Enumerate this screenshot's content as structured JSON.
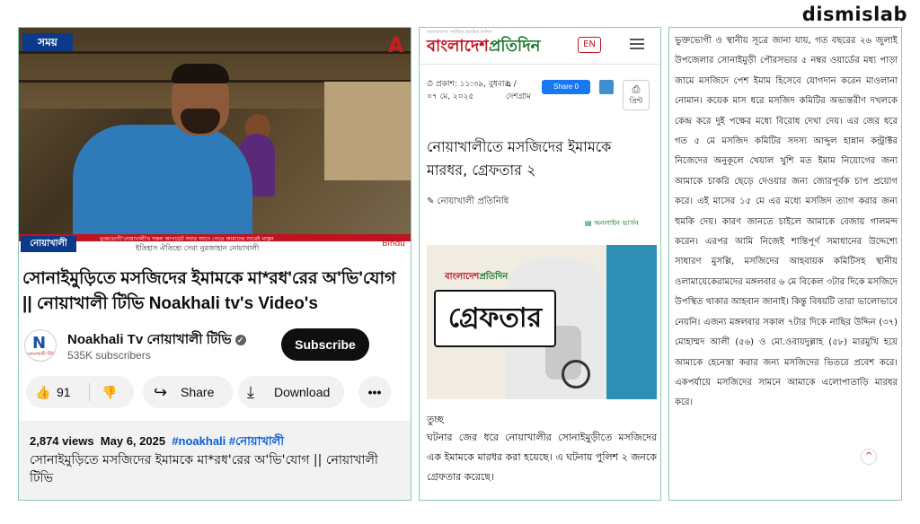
{
  "brand": "dismislab",
  "youtube": {
    "video_overlay": {
      "channel_logo_text": "সময়",
      "corner_logo": "A",
      "ticker_tag": "নোয়াখালী টিভি",
      "ticker_line1": "ভুক্তভোগী'নোয়াখালী'র সকল আপডেট সবার আগে পেতে আমাদের সাথেই থাকুন",
      "ticker_line2": "ইতিহাস ঐতিহ্যে সেরা নুরজাহান নোয়াখালী",
      "ticker_logo": "Bindu"
    },
    "title": "সোনাইমুড়িতে মসজিদের ইমামকে মা*রধ'রের অ'ভি'যোগ || নোয়াখালী টিভি Noakhali tv's Video's",
    "channel": {
      "avatar_letter": "N",
      "avatar_sub": "নোয়াখালী টিভি",
      "name": "Noakhali Tv নোয়াখালী টিভি",
      "subscribers": "535K subscribers",
      "subscribe_label": "Subscribe"
    },
    "actions": {
      "like_icon": "👍",
      "likes": "91",
      "dislike_icon": "👎",
      "share_icon": "↪",
      "share_label": "Share",
      "download_icon": "⤓",
      "download_label": "Download",
      "more_icon": "•••"
    },
    "description": {
      "views": "2,874 views",
      "date": "May 6, 2025",
      "tags": "#noakhali #নোয়াখালী",
      "text": "সোনাইমুড়িতে মসজিদের ইমামকে মা*রধ'রের অ'ভি'যোগ || নোয়াখালী টিভি"
    }
  },
  "pratidin": {
    "tagline": "বাংলাদেশের সর্বাধিক প্রচারিত দৈনিক",
    "logo_red": "বাংলাদেশ",
    "logo_green": "প্রতিদিন",
    "lang_button": "EN",
    "published": "⏱ প্রকাশ: ১১:৩৯, বুধবার, ০৭ মে, ২০২৫",
    "location": "⌂ / দেশগ্রাম",
    "fb_share": "Share 0",
    "print_label": "প্রিন্ট",
    "headline": "নোয়াখালীতে মসজিদের ইমামকে মারধর, গ্রেফতার ২",
    "author": "✎ নোয়াখালী প্রতিনিধি",
    "online_version": "▤ অনলাইন ভার্সন",
    "image_wordmark_red": "বাংলাদেশ",
    "image_wordmark_green": "প্রতিদিন",
    "image_text": "গ্রেফতার",
    "caption": "তুচ্ছ",
    "body": "ঘটনার জের ধরে নোয়াখালীর সোনাইমুড়ীতে মসজিদের এক ইমামকে মারধর করা হয়েছে। এ ঘটনায় পুলিশ ২ জনকে গ্রেফতার করেছে।"
  },
  "report_text": {
    "body": "ভুক্তভোগী ও স্থানীয় সূত্রে জানা যায়, গত বছরের ২৬ জুলাই উপজেলার সোনাইমুড়ী পৌরসভার ৫ নম্বর ওয়ার্ডের মধ্য পাড়া জামে মসজিদে পেশ ইমাম হিসেবে যোগদান করেন মাওলানা নোমান। কয়েক মাস ধরে মসজিদ কমিটির অভ্যন্তরীণ দখলকে কেন্দ্র করে দুই পক্ষের মধ্যে বিরোধ দেখা দেয়। এর জের ধরে গত ৫ মে মসজিদ কমিটির সদস্য আব্দুল হান্নান কন্ট্রাক্টর নিজেদের অনুকূলে খেয়াল খুশি মত ইমাম নিয়োগের জন্য আমাকে চাকরি ছেড়ে দেওয়ার জন্য জোরপূর্বক চাপ প্রয়োগ করে। এই মাসের ১৫ মে এর মধ্যে মসজিদ ত্যাগ করার জন্য হুমকি দেয়। কারণ জানতে চাইলে আমাকে বেজায় গালমন্দ করেন। এরপর আমি নিজেই শান্তিপূর্ণ সমাধানের উদ্দেশ্যে সাধারণ মুসল্লি, মসজিদের আহবায়ক কমিটিসহ স্থানীয় ওলামায়েকেরামদের মঙ্গলবার ৬ মে বিকেল ৩টার দিকে মসজিদে উপস্থিত থাকার আহবান জানাই। কিন্তু বিষয়টি তারা ভালোভাবে নেয়নি। এজন্য মঙ্গলবার সকাল ৭টার দিকে নাছির উদ্দিন (৩৭) মোহাম্মদ আলী (৫৬) ও মো.ওবায়দুল্লাহ (৫৮) মারমুখি হয়ে আমাকে হেনেস্তা করার জন্য মসজিদের ভিতরে প্রবেশ করে। একপর্যায়ে মসজিদের সামনে আমাকে এলোপাতাড়ি মারধর করে।",
    "scroll_icon": "^"
  }
}
